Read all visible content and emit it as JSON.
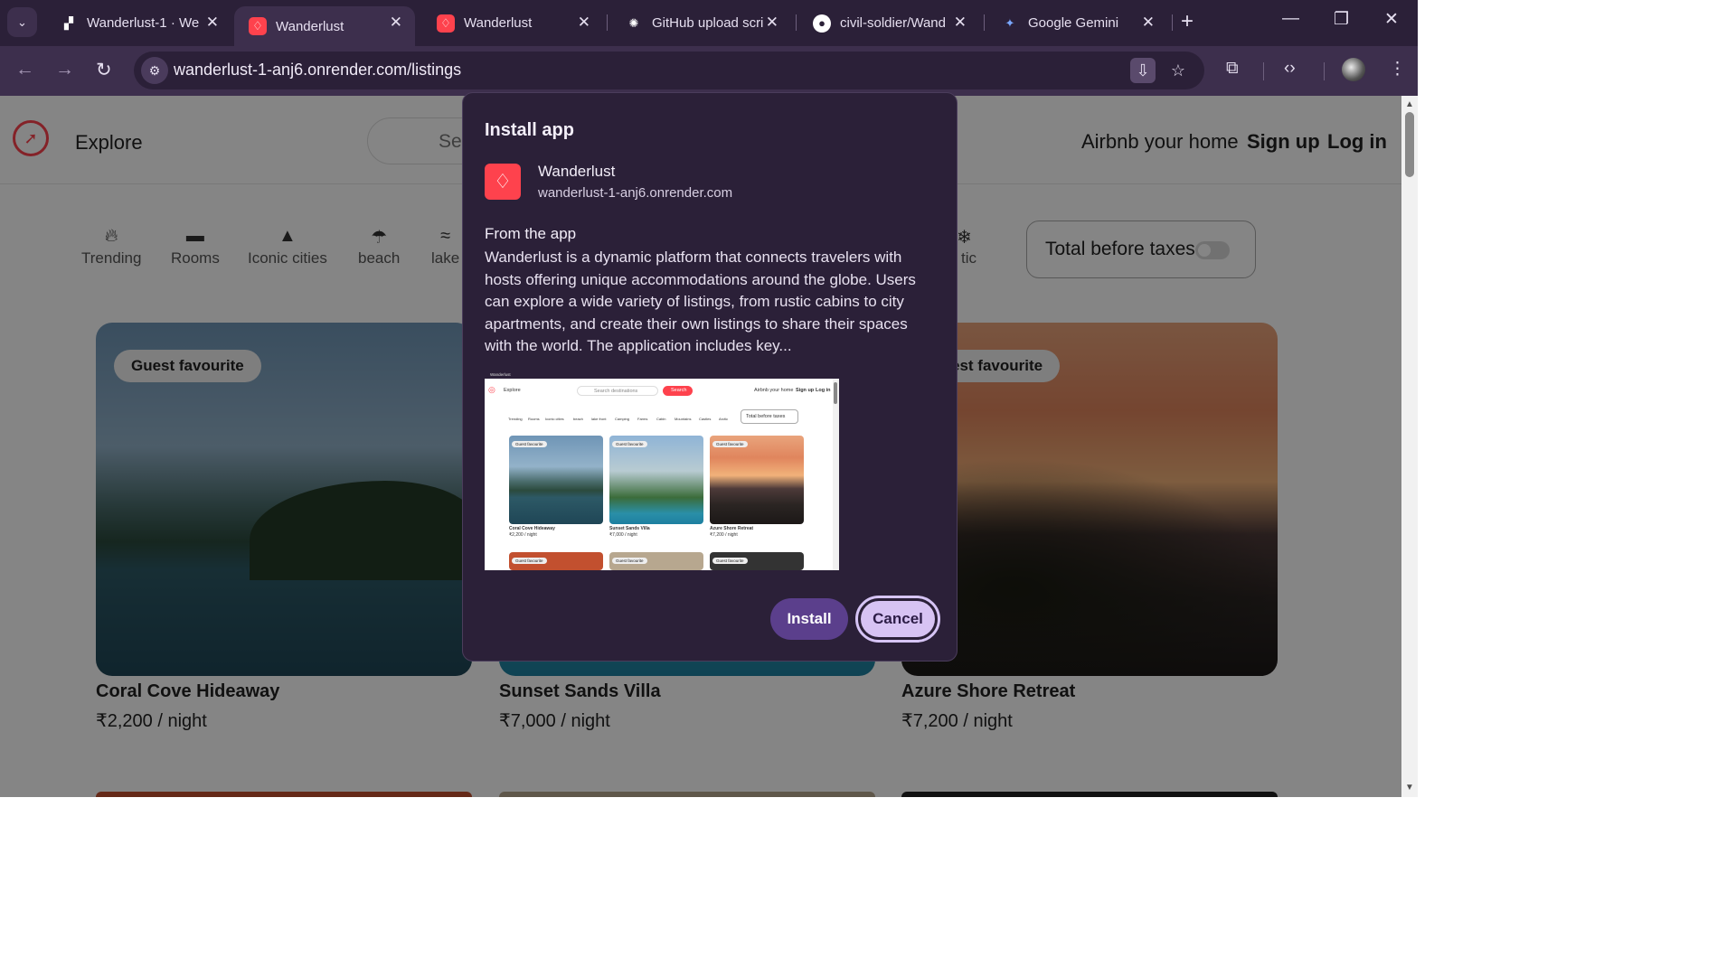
{
  "browser": {
    "tabs": [
      {
        "title": "Wanderlust-1 · We",
        "icon": "render-icon"
      },
      {
        "title": "Wanderlust",
        "icon": "airbnb-icon"
      },
      {
        "title": "Wanderlust",
        "icon": "airbnb-icon"
      },
      {
        "title": "GitHub upload scri",
        "icon": "openai-icon"
      },
      {
        "title": "civil-soldier/Wand",
        "icon": "github-icon"
      },
      {
        "title": "Google Gemini",
        "icon": "gemini-icon"
      }
    ],
    "url": "wanderlust-1-anj6.onrender.com/listings"
  },
  "site": {
    "nav": {
      "explore": "Explore",
      "search_placeholder": "Se",
      "airbnb_home": "Airbnb your home",
      "signup": "Sign up",
      "login": "Log in"
    },
    "filters": [
      "Trending",
      "Rooms",
      "Iconic cities",
      "beach",
      "lake"
    ],
    "filter_partial_right": "tic",
    "toggle_label": "Total before taxes",
    "toggle_on": false,
    "listings": [
      {
        "title": "Coral Cove Hideaway",
        "price": "₹2,200 / night",
        "badge": "Guest favourite"
      },
      {
        "title": "Sunset Sands Villa",
        "price": "₹7,000 / night",
        "badge": ""
      },
      {
        "title": "Azure Shore Retreat",
        "price": "₹7,200 / night",
        "badge": "est favourite"
      }
    ]
  },
  "dialog": {
    "title": "Install app",
    "app_name": "Wanderlust",
    "app_url": "wanderlust-1-anj6.onrender.com",
    "from_app_label": "From the app",
    "description": "Wanderlust is a dynamic platform that connects travelers with hosts offering unique accommodations around the globe. Users can explore a wide variety of listings, from rustic cabins to city apartments, and create their own listings to share their spaces with the world. The application includes key...",
    "install_label": "Install",
    "cancel_label": "Cancel",
    "preview": {
      "window_title": "Wanderlust",
      "explore": "Explore",
      "search_placeholder": "Search destinations",
      "search_button": "Search",
      "airbnb_home": "Airbnb your home",
      "signup": "Sign up",
      "login": "Log in",
      "filters": [
        "Trending",
        "Rooms",
        "Iconic cities",
        "beach",
        "lake front",
        "Camping",
        "Farms",
        "Cabin",
        "Mountains",
        "Castles",
        "Arctic"
      ],
      "toggle_label": "Total before taxes",
      "cards": [
        {
          "title": "Coral Cove Hideaway",
          "price": "₹2,200 / night",
          "badge": "Guest favourite"
        },
        {
          "title": "Sunset Sands Villa",
          "price": "₹7,000 / night",
          "badge": "Guest favourite"
        },
        {
          "title": "Azure Shore Retreat",
          "price": "₹7,200 / night",
          "badge": "Guest favourite"
        }
      ],
      "row2_badge": "Guest favourite"
    }
  },
  "colors": {
    "brand": "#fe424d",
    "chrome_dark": "#2b2038",
    "chrome_mid": "#3d2f4d",
    "install_button": "#5b3f8c",
    "cancel_button": "#d7c3f3"
  }
}
